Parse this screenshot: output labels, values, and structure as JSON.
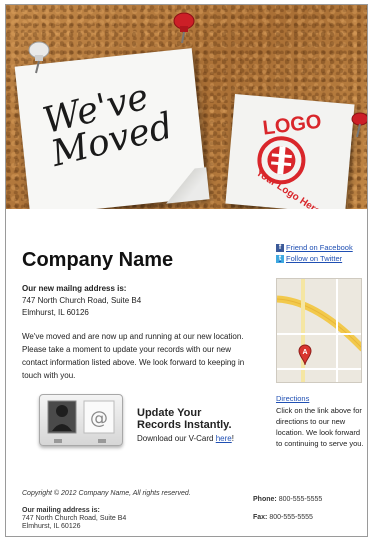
{
  "hero": {
    "headline": "We've\nMoved",
    "logo_top": "LOGO",
    "logo_bottom": "Your Logo Here"
  },
  "company": {
    "name": "Company Name"
  },
  "mailing": {
    "label": "Our new mailng address is:",
    "line1": "747 North Church Road, Suite B4",
    "line2": "Elmhurst, IL 60126"
  },
  "message": "We've moved and are now up and running at our new location. Please take a moment to update your records with our new contact information listed above. We look forward to keeping in touch with you.",
  "social": {
    "facebook_label": "Friend on Facebook",
    "twitter_label": "Follow on Twitter"
  },
  "map": {
    "marker_label": "A"
  },
  "directions": {
    "link_label": "Directions",
    "text": "Click on the link above for directions to our new location. We look forward to continuing to serve you."
  },
  "vcard": {
    "title": "Update Your Records Instantly.",
    "download_prefix": "Download our V-Card ",
    "download_link": "here",
    "download_suffix": "!"
  },
  "footer": {
    "copyright": "Copyright © 2012 Company Name, All rights reserved.",
    "mailing_label": "Our mailing address is:",
    "line1": "747 North Church Road, Suite B4",
    "line2": "Elmhurst, IL 60126",
    "phone_label": "Phone:",
    "phone_value": "800-555-5555",
    "fax_label": "Fax:",
    "fax_value": "800-555-5555"
  },
  "colors": {
    "link": "#1f4fb3",
    "logo_red": "#d9262b",
    "pin_red": "#cc1f27"
  }
}
